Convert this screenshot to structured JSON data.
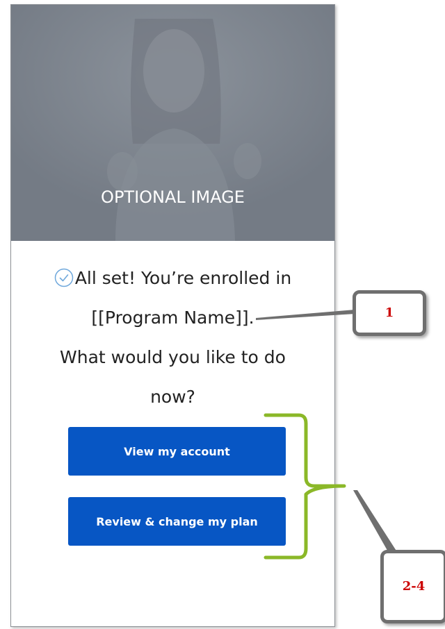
{
  "hero": {
    "caption": "OPTIONAL IMAGE"
  },
  "message": {
    "line1": "All set!  You’re enrolled in",
    "line2": "[[Program Name]].",
    "line3": "What would you like to do",
    "line4": "now?"
  },
  "buttons": {
    "view_account": "View my account",
    "review_plan": "Review & change my plan"
  },
  "annotations": {
    "callout_1": "1",
    "callout_2": "2-4"
  },
  "colors": {
    "button_blue": "#0756c4",
    "hero_gray": "#7a818b",
    "annotation_red": "#cc0000",
    "bracket_green": "#8bb828",
    "callout_gray": "#6f6f6f"
  },
  "icons": {
    "check": "check-circle-icon"
  }
}
